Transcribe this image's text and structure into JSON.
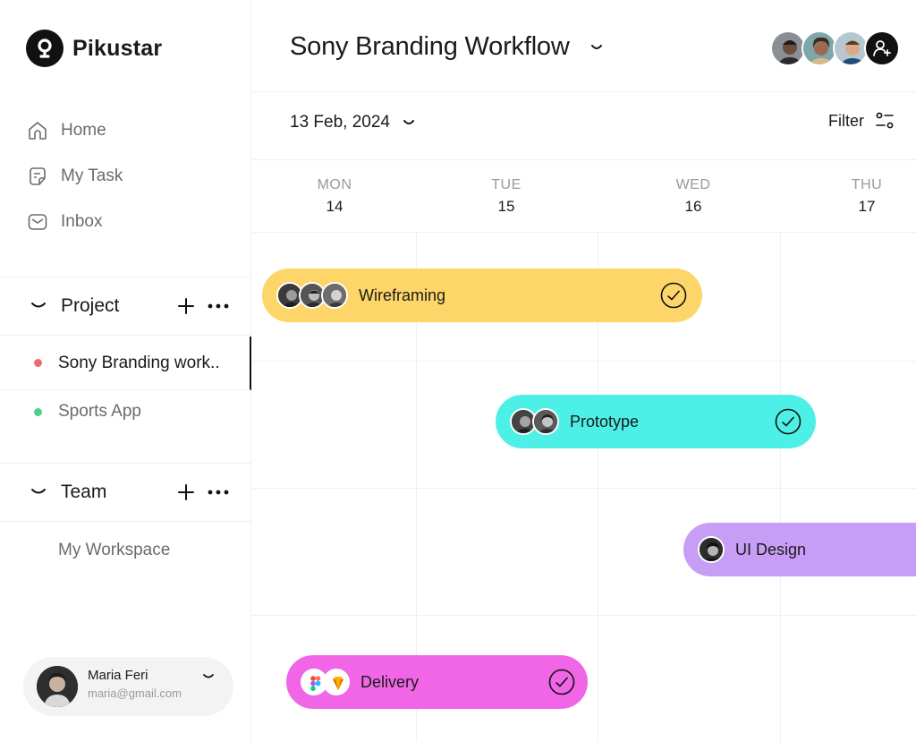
{
  "sidebar": {
    "brand": "Pikustar",
    "nav": [
      {
        "label": "Home",
        "icon": "home-icon"
      },
      {
        "label": "My Task",
        "icon": "note-icon"
      },
      {
        "label": "Inbox",
        "icon": "inbox-icon"
      }
    ],
    "project_section": {
      "title": "Project",
      "items": [
        {
          "label": "Sony Branding work..",
          "dot_color": "#ef6b6b",
          "active": true
        },
        {
          "label": "Sports App",
          "dot_color": "#4fd08a",
          "active": false
        }
      ]
    },
    "team_section": {
      "title": "Team",
      "items": [
        {
          "label": "My Workspace"
        }
      ]
    },
    "user": {
      "name": "Maria Feri",
      "email": "maria@gmail.com"
    }
  },
  "header": {
    "title": "Sony Branding Workflow",
    "date": "13 Feb, 2024",
    "filter_label": "Filter"
  },
  "calendar": {
    "days": [
      {
        "name": "MON",
        "num": "14"
      },
      {
        "name": "TUE",
        "num": "15"
      },
      {
        "name": "WED",
        "num": "16"
      },
      {
        "name": "THU",
        "num": "17"
      }
    ],
    "tasks": [
      {
        "label": "Wireframing",
        "color": "#fdd568",
        "assignees": 3,
        "done": true
      },
      {
        "label": "Prototype",
        "color": "#4df0e6",
        "assignees": 2,
        "done": true
      },
      {
        "label": "UI Design",
        "color": "#c89df6",
        "assignees": 1,
        "done": false
      },
      {
        "label": "Delivery",
        "color": "#f066e6",
        "apps": [
          "figma-icon",
          "sketch-icon"
        ],
        "done": true
      }
    ]
  }
}
